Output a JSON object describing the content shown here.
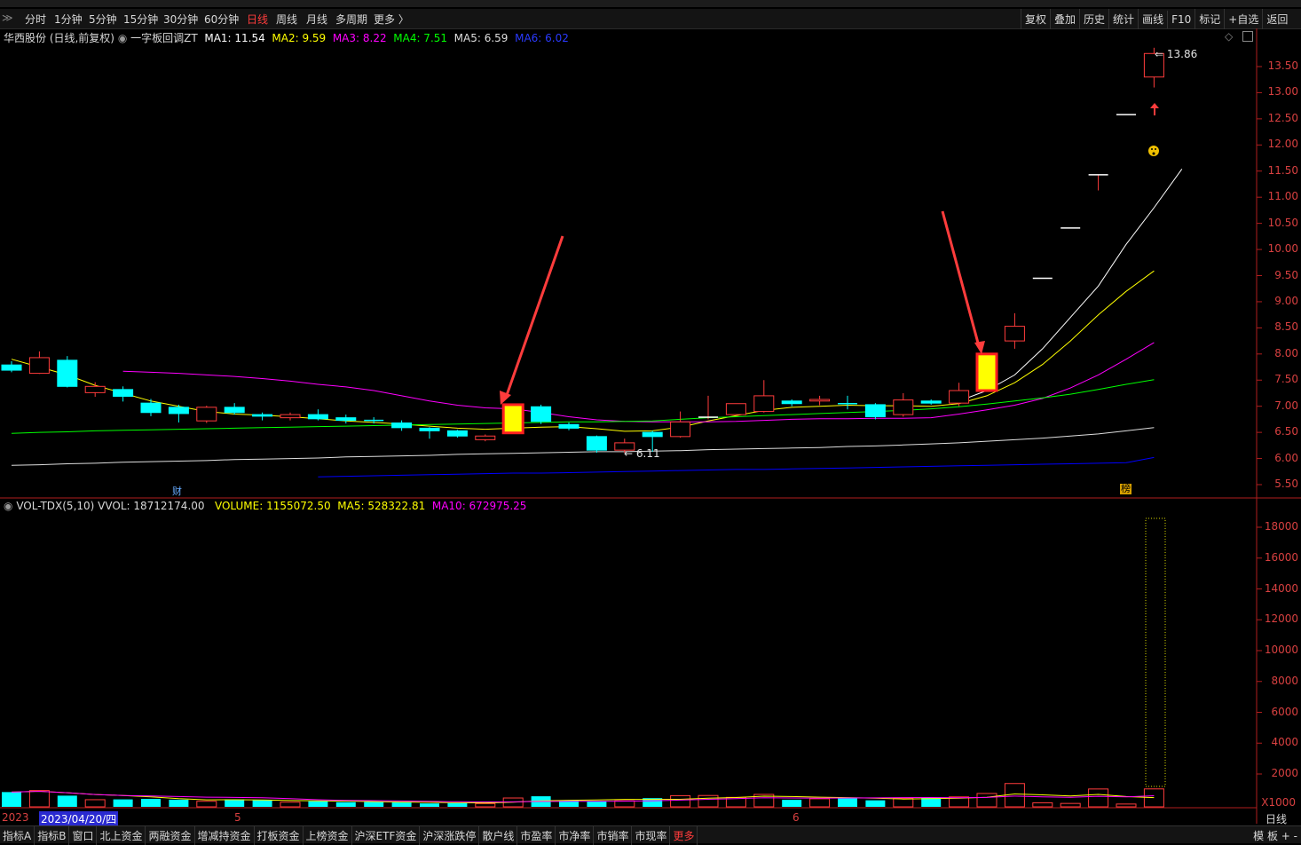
{
  "toolbar": {
    "periods": [
      "分时",
      "1分钟",
      "5分钟",
      "15分钟",
      "30分钟",
      "60分钟",
      "日线",
      "周线",
      "月线",
      "多周期",
      "更多 〉"
    ],
    "active_period": "日线",
    "right_buttons": [
      "复权",
      "叠加",
      "历史",
      "统计",
      "画线",
      "F10",
      "标记",
      "+自选",
      "返回"
    ]
  },
  "chart_header": {
    "stock": "华西股份 (日线,前复权)",
    "formula": "一字板回调ZT",
    "ma1": "MA1: 11.54",
    "ma2": "MA2: 9.59",
    "ma3": "MA3: 8.22",
    "ma4": "MA4: 7.51",
    "ma5": "MA5: 6.59",
    "ma6": "MA6: 6.02"
  },
  "volume_header": {
    "name": "VOL-TDX(5,10)",
    "vvol": "VVOL: 18712174.00",
    "volume": "VOLUME: 1155072.50",
    "ma5": "MA5: 528322.81",
    "ma10": "MA10: 672975.25"
  },
  "price_axis": [
    "13.50",
    "13.00",
    "12.50",
    "12.00",
    "11.50",
    "11.00",
    "10.50",
    "10.00",
    "9.50",
    "9.00",
    "8.50",
    "8.00",
    "7.50",
    "7.00",
    "6.50",
    "6.00",
    "5.50"
  ],
  "volume_axis": [
    "18000",
    "16000",
    "14000",
    "12000",
    "10000",
    "8000",
    "6000",
    "4000",
    "2000"
  ],
  "volume_unit": "X1000",
  "annotations": {
    "high_label": "13.86",
    "low_label": "6.11",
    "fin_marker": "财",
    "rank_marker": "榜"
  },
  "dates": {
    "year": "2023",
    "cursor_date": "2023/04/20/四",
    "month5": "5",
    "month6": "6"
  },
  "bottom_tabs": [
    "指标A",
    "指标B",
    "窗口",
    "北上资金",
    "两融资金",
    "增减持资金",
    "打板资金",
    "上榜资金",
    "沪深ETF资金",
    "沪深涨跌停",
    "散户线",
    "市盈率",
    "市净率",
    "市销率",
    "市现率",
    "更多"
  ],
  "bottom_active": "更多",
  "bottom_right": "模 板  +  -",
  "period_label": "日线",
  "colors": {
    "up": "#ff3c3c",
    "down": "#00ffff",
    "ma1": "#ffffff",
    "ma2": "#ffff00",
    "ma3": "#ff00ff",
    "ma4": "#00ff00",
    "ma5": "#dddddd",
    "ma6": "#0000ff"
  },
  "chart_data": {
    "type": "candlestick",
    "y_range": [
      5.3,
      13.95
    ],
    "candles": [
      {
        "o": 7.79,
        "c": 7.69,
        "h": 7.86,
        "l": 7.65
      },
      {
        "o": 7.63,
        "c": 7.93,
        "h": 8.05,
        "l": 7.62
      },
      {
        "o": 7.88,
        "c": 7.38,
        "h": 7.96,
        "l": 7.36
      },
      {
        "o": 7.26,
        "c": 7.38,
        "h": 7.46,
        "l": 7.18
      },
      {
        "o": 7.32,
        "c": 7.19,
        "h": 7.38,
        "l": 7.09
      },
      {
        "o": 7.06,
        "c": 6.88,
        "h": 7.14,
        "l": 6.81
      },
      {
        "o": 6.98,
        "c": 6.86,
        "h": 7.03,
        "l": 6.69
      },
      {
        "o": 6.72,
        "c": 6.98,
        "h": 7.01,
        "l": 6.68
      },
      {
        "o": 6.98,
        "c": 6.88,
        "h": 7.06,
        "l": 6.84
      },
      {
        "o": 6.84,
        "c": 6.81,
        "h": 6.88,
        "l": 6.73
      },
      {
        "o": 6.78,
        "c": 6.84,
        "h": 6.88,
        "l": 6.73
      },
      {
        "o": 6.84,
        "c": 6.76,
        "h": 6.94,
        "l": 6.73
      },
      {
        "o": 6.78,
        "c": 6.73,
        "h": 6.84,
        "l": 6.67
      },
      {
        "o": 6.73,
        "c": 6.71,
        "h": 6.79,
        "l": 6.67
      },
      {
        "o": 6.68,
        "c": 6.59,
        "h": 6.73,
        "l": 6.53
      },
      {
        "o": 6.58,
        "c": 6.53,
        "h": 6.6,
        "l": 6.38
      },
      {
        "o": 6.53,
        "c": 6.43,
        "h": 6.55,
        "l": 6.4
      },
      {
        "o": 6.36,
        "c": 6.43,
        "h": 6.46,
        "l": 6.33
      },
      {
        "o": 6.49,
        "c": 7.03,
        "h": 7.03,
        "l": 6.49,
        "hl": true
      },
      {
        "o": 6.99,
        "c": 6.71,
        "h": 7.03,
        "l": 6.66
      },
      {
        "o": 6.65,
        "c": 6.58,
        "h": 6.69,
        "l": 6.54
      },
      {
        "o": 6.42,
        "c": 6.16,
        "h": 6.44,
        "l": 6.11
      },
      {
        "o": 6.16,
        "c": 6.3,
        "h": 6.38,
        "l": 6.11
      },
      {
        "o": 6.5,
        "c": 6.42,
        "h": 6.53,
        "l": 6.13
      },
      {
        "o": 6.42,
        "c": 6.7,
        "h": 6.9,
        "l": 6.4
      },
      {
        "o": 6.78,
        "c": 6.79,
        "h": 7.2,
        "l": 6.75
      },
      {
        "o": 6.84,
        "c": 7.05,
        "h": 7.05,
        "l": 6.84
      },
      {
        "o": 6.9,
        "c": 7.2,
        "h": 7.5,
        "l": 6.88
      },
      {
        "o": 7.1,
        "c": 7.05,
        "h": 7.13,
        "l": 7.0
      },
      {
        "o": 7.1,
        "c": 7.13,
        "h": 7.2,
        "l": 7.02
      },
      {
        "o": 7.05,
        "c": 7.03,
        "h": 7.2,
        "l": 6.94
      },
      {
        "o": 7.03,
        "c": 6.8,
        "h": 7.06,
        "l": 6.75
      },
      {
        "o": 6.84,
        "c": 7.12,
        "h": 7.25,
        "l": 6.8
      },
      {
        "o": 7.1,
        "c": 7.06,
        "h": 7.13,
        "l": 7.03
      },
      {
        "o": 7.06,
        "c": 7.3,
        "h": 7.45,
        "l": 7.0
      },
      {
        "o": 7.3,
        "c": 8.0,
        "h": 8.0,
        "l": 7.3,
        "hl": true
      },
      {
        "o": 8.25,
        "c": 8.53,
        "h": 8.78,
        "l": 8.1
      },
      {
        "o": 9.45,
        "c": 9.45,
        "h": 9.45,
        "l": 9.45
      },
      {
        "o": 10.41,
        "c": 10.41,
        "h": 10.41,
        "l": 10.41
      },
      {
        "o": 11.43,
        "c": 11.43,
        "h": 11.43,
        "l": 11.13
      },
      {
        "o": 12.58,
        "c": 12.58,
        "h": 12.58,
        "l": 12.58
      },
      {
        "o": 13.3,
        "c": 13.75,
        "h": 13.86,
        "l": 13.1
      }
    ],
    "ma_lines": [
      {
        "name": "MA1",
        "color": "#ffffff",
        "start": 34,
        "values": [
          7.1,
          7.3,
          7.6,
          8.1,
          8.7,
          9.3,
          10.1,
          10.8,
          11.54
        ]
      },
      {
        "name": "MA2",
        "color": "#ffff00",
        "start": 0,
        "values": [
          7.9,
          7.75,
          7.6,
          7.4,
          7.25,
          7.1,
          7.0,
          6.9,
          6.85,
          6.83,
          6.8,
          6.76,
          6.72,
          6.69,
          6.66,
          6.62,
          6.58,
          6.56,
          6.58,
          6.6,
          6.61,
          6.57,
          6.52,
          6.53,
          6.6,
          6.72,
          6.82,
          6.92,
          6.98,
          7.0,
          7.02,
          7.01,
          7.01,
          7.0,
          7.05,
          7.2,
          7.45,
          7.8,
          8.25,
          8.75,
          9.2,
          9.59
        ]
      },
      {
        "name": "MA3",
        "color": "#ff00ff",
        "start": 4,
        "values": [
          7.67,
          7.65,
          7.63,
          7.6,
          7.57,
          7.53,
          7.48,
          7.42,
          7.37,
          7.3,
          7.2,
          7.1,
          7.02,
          6.97,
          6.95,
          6.88,
          6.8,
          6.74,
          6.71,
          6.7,
          6.7,
          6.7,
          6.71,
          6.73,
          6.75,
          6.76,
          6.76,
          6.77,
          6.77,
          6.78,
          6.85,
          6.93,
          7.02,
          7.15,
          7.35,
          7.6,
          7.9,
          8.22
        ]
      },
      {
        "name": "MA4",
        "color": "#00ff00",
        "start": 0,
        "values": [
          6.48,
          6.5,
          6.51,
          6.53,
          6.54,
          6.55,
          6.56,
          6.57,
          6.58,
          6.59,
          6.6,
          6.61,
          6.62,
          6.63,
          6.64,
          6.65,
          6.66,
          6.67,
          6.68,
          6.69,
          6.7,
          6.7,
          6.71,
          6.72,
          6.75,
          6.78,
          6.8,
          6.82,
          6.84,
          6.86,
          6.88,
          6.9,
          6.92,
          6.95,
          6.99,
          7.04,
          7.1,
          7.16,
          7.23,
          7.32,
          7.42,
          7.51
        ]
      },
      {
        "name": "MA5",
        "color": "#dddddd",
        "start": 0,
        "values": [
          5.87,
          5.88,
          5.9,
          5.91,
          5.93,
          5.94,
          5.95,
          5.96,
          5.98,
          5.99,
          6.0,
          6.01,
          6.03,
          6.04,
          6.05,
          6.06,
          6.08,
          6.09,
          6.1,
          6.11,
          6.12,
          6.13,
          6.13,
          6.14,
          6.15,
          6.17,
          6.18,
          6.19,
          6.2,
          6.21,
          6.23,
          6.24,
          6.26,
          6.28,
          6.3,
          6.33,
          6.36,
          6.39,
          6.43,
          6.47,
          6.53,
          6.59
        ]
      },
      {
        "name": "MA6",
        "color": "#0000ff",
        "start": 11,
        "values": [
          5.65,
          5.66,
          5.67,
          5.68,
          5.69,
          5.7,
          5.71,
          5.72,
          5.72,
          5.73,
          5.74,
          5.75,
          5.76,
          5.77,
          5.78,
          5.79,
          5.79,
          5.8,
          5.81,
          5.82,
          5.83,
          5.84,
          5.85,
          5.86,
          5.87,
          5.88,
          5.89,
          5.9,
          5.91,
          5.92,
          6.02
        ]
      }
    ],
    "volume_max": 19000,
    "volumes": [
      950,
      1050,
      720,
      460,
      480,
      510,
      460,
      360,
      480,
      420,
      300,
      360,
      300,
      310,
      280,
      220,
      240,
      210,
      570,
      680,
      400,
      360,
      390,
      560,
      720,
      730,
      610,
      800,
      450,
      520,
      580,
      420,
      550,
      600,
      640,
      860,
      1500,
      260,
      220,
      1150,
      180,
      1155
    ]
  }
}
